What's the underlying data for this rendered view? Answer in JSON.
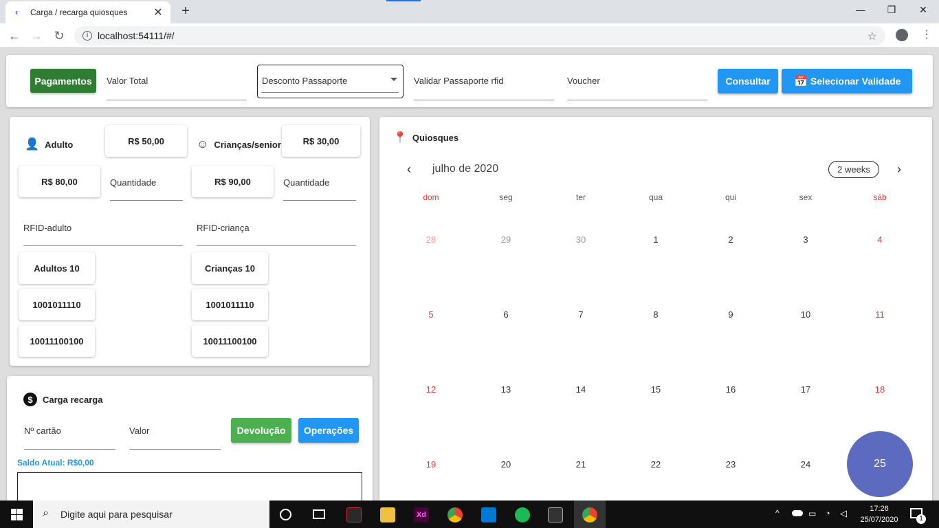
{
  "browser": {
    "tab_title": "Carga / recarga quiosques",
    "url": "localhost:54111/#/",
    "new_tab": "+",
    "tab_close": "✕"
  },
  "topbar": {
    "pagamentos": "Pagamentos",
    "valor_total": "Valor Total",
    "desconto_select": "Desconto Passaporte",
    "validar": "Validar Passaporte rfid",
    "voucher": "Voucher",
    "consultar": "Consultar",
    "selecionar_validade": "Selecionar Validade"
  },
  "tickets": {
    "adulto_label": "Adulto",
    "adulto_price": "R$ 50,00",
    "criancas_label": "Crianças/senior",
    "criancas_price": "R$ 30,00",
    "adulto_total": "R$ 80,00",
    "adulto_qty": "Quantidade",
    "criancas_total": "R$ 90,00",
    "criancas_qty": "Quantidade",
    "rfid_adulto": "RFID-adulto",
    "rfid_crianca": "RFID-criança",
    "adultos_count": "Adultos 10",
    "adultos_ids": [
      "1001011110",
      "10011100100"
    ],
    "criancas_count": "Crianças 10",
    "criancas_ids": [
      "1001011110",
      "10011100100"
    ]
  },
  "carga": {
    "title": "Carga recarga",
    "cartao": "Nº cartão",
    "valor": "Valor",
    "devolucao": "Devolução",
    "operacoes": "Operações",
    "saldo": "Saldo Atual: R$0,00"
  },
  "calendar": {
    "title": "Quiosques",
    "month": "julho de 2020",
    "view_mode": "2 weeks",
    "weekdays": [
      "dom",
      "seg",
      "ter",
      "qua",
      "qui",
      "sex",
      "sáb"
    ],
    "weeks": [
      [
        "28",
        "29",
        "30",
        "1",
        "2",
        "3",
        "4"
      ],
      [
        "5",
        "6",
        "7",
        "8",
        "9",
        "10",
        "11"
      ],
      [
        "12",
        "13",
        "14",
        "15",
        "16",
        "17",
        "18"
      ],
      [
        "19",
        "20",
        "21",
        "22",
        "23",
        "24",
        "25"
      ]
    ],
    "selected_day": "25",
    "weekend_color": "#e53935",
    "selected_color": "#5c6bc0"
  },
  "taskbar": {
    "search_placeholder": "Digite aqui para pesquisar",
    "time": "17:26",
    "date": "25/07/2020",
    "notification_count": "1"
  }
}
